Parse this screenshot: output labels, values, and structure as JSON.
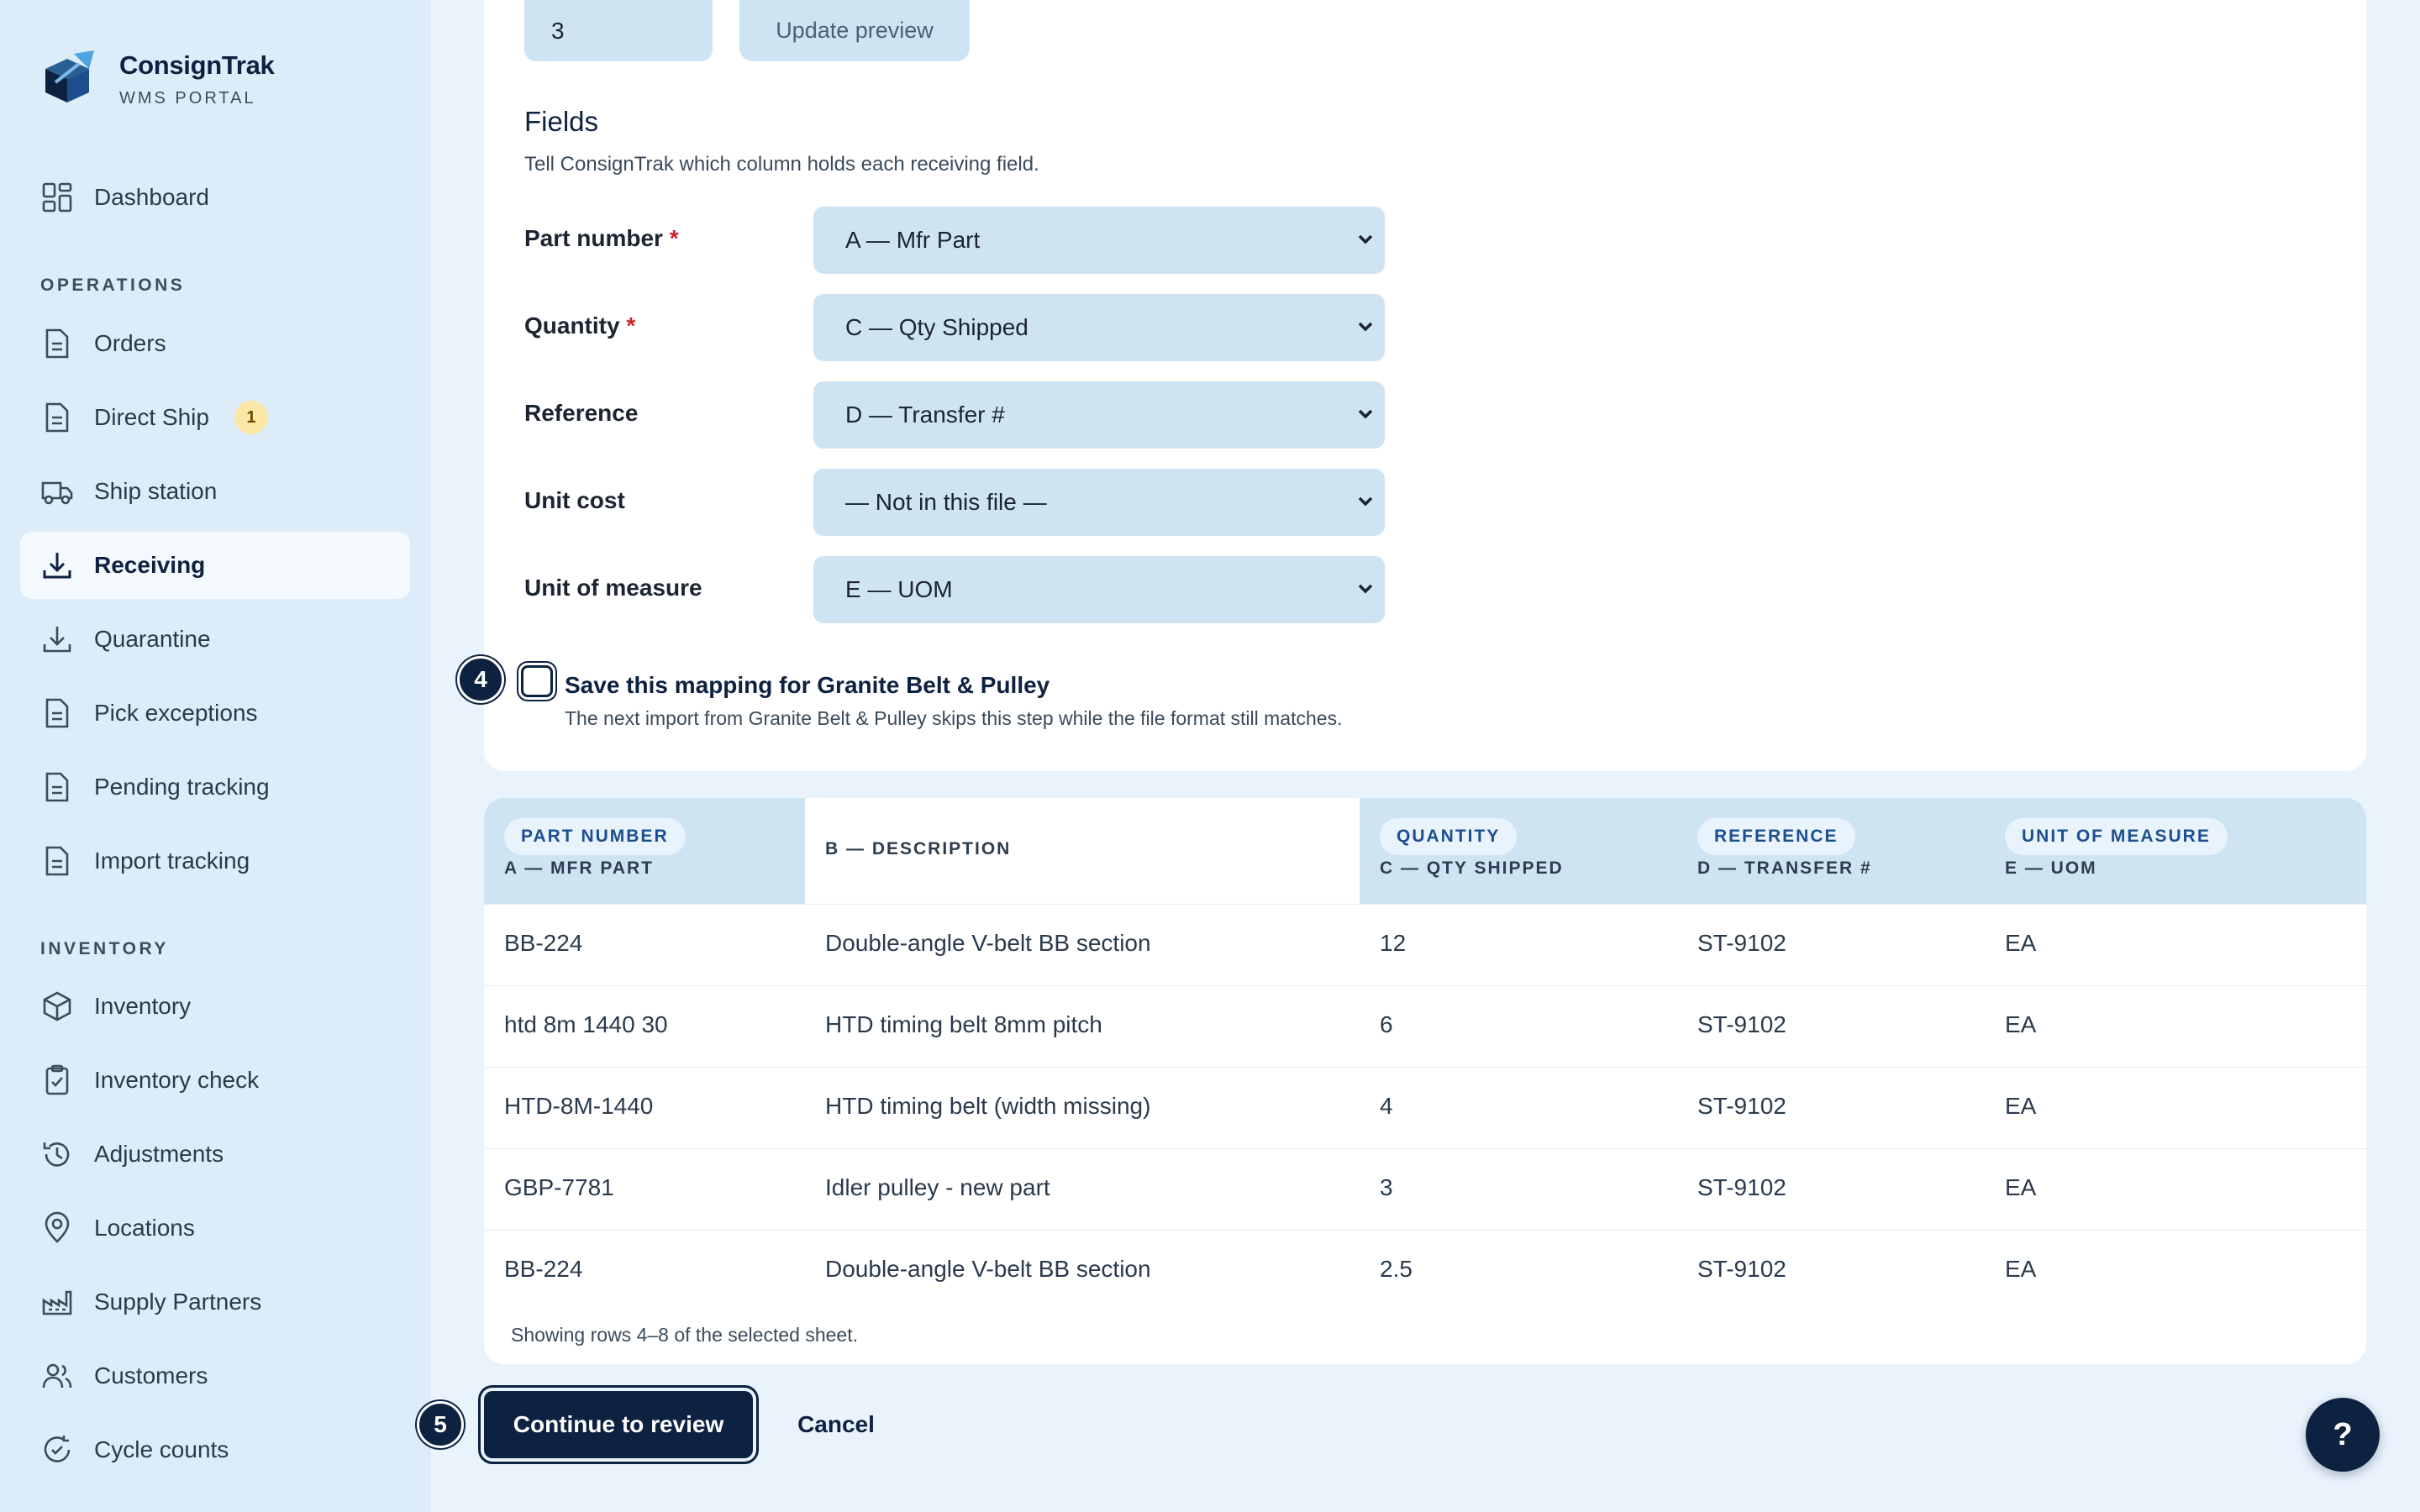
{
  "brand": {
    "name": "ConsignTrak",
    "subtitle": "WMS PORTAL"
  },
  "sidebar": {
    "dashboard": "Dashboard",
    "sections": {
      "operations": "OPERATIONS",
      "inventory": "INVENTORY"
    },
    "operations": [
      {
        "label": "Orders",
        "icon": "document-icon"
      },
      {
        "label": "Direct Ship",
        "icon": "document-icon",
        "badge": "1"
      },
      {
        "label": "Ship station",
        "icon": "truck-icon"
      },
      {
        "label": "Receiving",
        "icon": "download-icon",
        "active": true
      },
      {
        "label": "Quarantine",
        "icon": "download-icon"
      },
      {
        "label": "Pick exceptions",
        "icon": "document-icon"
      },
      {
        "label": "Pending tracking",
        "icon": "document-icon"
      },
      {
        "label": "Import tracking",
        "icon": "document-icon"
      }
    ],
    "inventory": [
      {
        "label": "Inventory",
        "icon": "box-icon"
      },
      {
        "label": "Inventory check",
        "icon": "clipboard-check-icon"
      },
      {
        "label": "Adjustments",
        "icon": "history-icon"
      },
      {
        "label": "Locations",
        "icon": "map-pin-icon"
      },
      {
        "label": "Supply Partners",
        "icon": "factory-icon"
      },
      {
        "label": "Customers",
        "icon": "users-icon"
      },
      {
        "label": "Cycle counts",
        "icon": "refresh-check-icon"
      }
    ]
  },
  "header_row": {
    "header_row_value": "3",
    "update_preview_label": "Update preview"
  },
  "fields": {
    "title": "Fields",
    "description": "Tell ConsignTrak which column holds each receiving field.",
    "items": [
      {
        "label": "Part number",
        "required": "*",
        "value": "A — Mfr Part"
      },
      {
        "label": "Quantity",
        "required": "*",
        "value": "C — Qty Shipped"
      },
      {
        "label": "Reference",
        "value": "D — Transfer #"
      },
      {
        "label": "Unit cost",
        "value": "— Not in this file —"
      },
      {
        "label": "Unit of measure",
        "value": "E — UOM"
      }
    ]
  },
  "save_mapping": {
    "step": "4",
    "label": "Save this mapping for Granite Belt & Pulley",
    "help": "The next import from Granite Belt & Pulley skips this step while the file format still matches."
  },
  "preview_table": {
    "columns": [
      {
        "chip": "PART NUMBER",
        "source": "A — MFR PART"
      },
      {
        "chip": "",
        "source": "B — DESCRIPTION"
      },
      {
        "chip": "QUANTITY",
        "source": "C — QTY SHIPPED"
      },
      {
        "chip": "REFERENCE",
        "source": "D — TRANSFER #"
      },
      {
        "chip": "UNIT OF MEASURE",
        "source": "E — UOM"
      }
    ],
    "rows": [
      [
        "BB-224",
        "Double-angle V-belt BB section",
        "12",
        "ST-9102",
        "EA"
      ],
      [
        "htd 8m 1440 30",
        "HTD timing belt 8mm pitch",
        "6",
        "ST-9102",
        "EA"
      ],
      [
        "HTD-8M-1440",
        "HTD timing belt (width missing)",
        "4",
        "ST-9102",
        "EA"
      ],
      [
        "GBP-7781",
        "Idler pulley - new part",
        "3",
        "ST-9102",
        "EA"
      ],
      [
        "BB-224",
        "Double-angle V-belt BB section",
        "2.5",
        "ST-9102",
        "EA"
      ]
    ],
    "footer": "Showing rows 4–8 of the selected sheet."
  },
  "actions": {
    "step": "5",
    "continue_label": "Continue to review",
    "cancel_label": "Cancel",
    "help_label": "?"
  },
  "colors": {
    "accent": "#0d2140",
    "select_bg": "#cfe4f3",
    "page_bg": "#e9f3fc",
    "required": "#d4202a"
  }
}
